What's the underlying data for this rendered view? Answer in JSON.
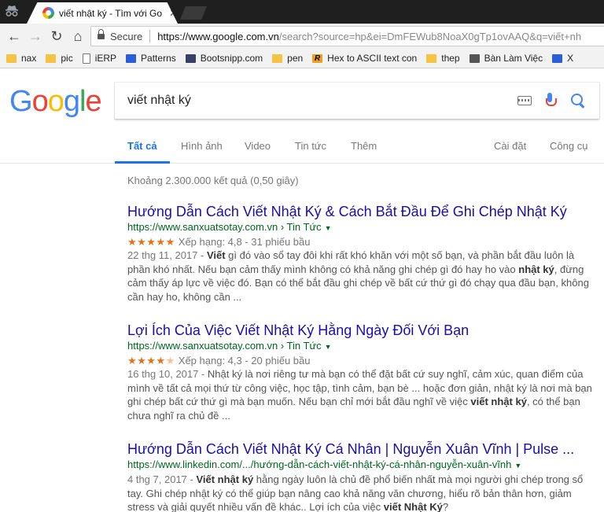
{
  "browser": {
    "tab_title": "viết nhật ký - Tìm với Go",
    "tab_close": "✕",
    "secure_label": "Secure",
    "url_scheme": "https://",
    "url_host": "www.google.com.vn",
    "url_path": "/search?source=hp&ei=DmFEWub8NoaX0gTp1ovAAQ&q=viết+nh",
    "bookmarks": [
      {
        "label": "nax",
        "icon": "folder-icon"
      },
      {
        "label": "pic",
        "icon": "folder-icon"
      },
      {
        "label": "iERP",
        "icon": "page-icon"
      },
      {
        "label": "Patterns",
        "icon": "patterns-icon"
      },
      {
        "label": "Bootsnipp.com",
        "icon": "bootsnipp-icon"
      },
      {
        "label": "pen",
        "icon": "folder-icon"
      },
      {
        "label": "Hex to ASCII text con",
        "icon": "r-icon"
      },
      {
        "label": "thep",
        "icon": "folder-icon"
      },
      {
        "label": "Bàn Làm Việc",
        "icon": "person-icon"
      },
      {
        "label": "X",
        "icon": "patterns-icon"
      }
    ]
  },
  "search": {
    "query": "viết nhật ký",
    "logo": [
      "G",
      "o",
      "o",
      "g",
      "l",
      "e"
    ],
    "logo_colors": [
      "#4285f4",
      "#ea4335",
      "#fbbc05",
      "#4285f4",
      "#34a853",
      "#ea4335"
    ],
    "tabs": {
      "all": "Tất cả",
      "images": "Hình ảnh",
      "video": "Video",
      "news": "Tin tức",
      "more": "Thêm",
      "settings": "Cài đặt",
      "tools": "Công cụ"
    },
    "stats": "Khoảng 2.300.000 kết quả (0,50 giây)"
  },
  "results": [
    {
      "title": "Hướng Dẫn Cách Viết Nhật Ký & Cách Bắt Đầu Để Ghi Chép Nhật Ký",
      "url": "https://www.sanxuatsotay.com.vn › Tin Tức",
      "stars": "★★★★★",
      "rating": "Xếp hạng: 4,8 - 31 phiếu bầu",
      "date": "22 thg 11, 2017 - ",
      "snippet_html": "<b>Viết</b> gì đó vào sổ tay đôi khi rất khó khăn với một số bạn, và phần bắt đầu luôn là phần khó nhất. Nếu bạn cảm thấy mình không có khả năng ghi chép gì đó hay ho vào <b>nhật ký</b>, đừng cảm thấy áp lực về việc đó. Bạn có thể bắt đầu ghi chép về bất cứ thứ gì đó chạy qua đầu bạn, không cần hay ho, không cần ..."
    },
    {
      "title": "Lợi Ích Của Việc Viết Nhật Ký Hằng Ngày Đối Với Bạn",
      "url": "https://www.sanxuatsotay.com.vn › Tin Tức",
      "stars": "★★★★★",
      "rating": "Xếp hạng: 4,3 - 20 phiếu bầu",
      "date": "16 thg 10, 2017 - ",
      "snippet_html": "Nhật ký là nơi riêng tư mà bạn có thể đặt bất cứ suy nghĩ, cảm xúc, quan điểm của mình về tất cả mọi thứ từ công việc, học tập, tình cảm, bạn bè ... hoặc đơn giản, nhật ký là nơi mà bạn ghi chép bất cứ thứ gì mà bạn muốn. Nếu bạn chỉ mới bắt đầu nghĩ về việc <b>viết nhật ký</b>, có thể bạn chưa nghĩ ra chủ đề ..."
    },
    {
      "title": "Hướng Dẫn Cách Viết Nhật Ký Cá Nhân | Nguyễn Xuân Vĩnh | Pulse ...",
      "url": "https://www.linkedin.com/.../hướng-dẫn-cách-viết-nhật-ký-cá-nhân-nguyễn-xuân-vĩnh",
      "stars": "",
      "rating": "",
      "date": "4 thg 7, 2017 - ",
      "snippet_html": "<b>Viết nhật ký</b> hằng ngày luôn là chủ đề phổ biến nhất mà mọi người ghi chép trong sổ tay. Ghi chép nhật ký có thể giúp bạn nâng cao khả năng văn chương, hiểu rõ bản thân hơn, giảm stress và giải quyết nhiều vấn đề khác.. Lợi ích của việc <b>viết Nhật Ký</b>?"
    }
  ],
  "colors": {
    "link": "#1a0dab",
    "url": "#006621",
    "star": "#e7711b",
    "active_tab": "#1a73e8"
  }
}
